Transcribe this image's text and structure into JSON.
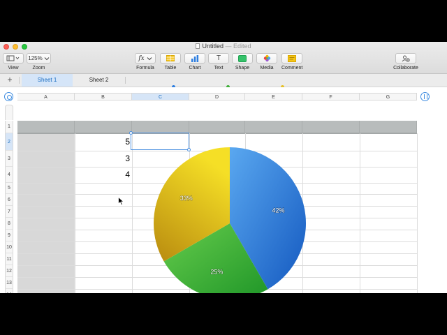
{
  "window": {
    "title": "Untitled",
    "status": "— Edited"
  },
  "toolbar": {
    "view": {
      "label": "View"
    },
    "zoom": {
      "label": "Zoom",
      "value": "125%"
    },
    "formula": {
      "label": "Formula",
      "button_text": "fx"
    },
    "table": {
      "label": "Table"
    },
    "chart": {
      "label": "Chart"
    },
    "text": {
      "label": "Text",
      "button_text": "T"
    },
    "shape": {
      "label": "Shape"
    },
    "media": {
      "label": "Media"
    },
    "comment": {
      "label": "Comment"
    },
    "collaborate": {
      "label": "Collaborate"
    }
  },
  "sheets": {
    "add": "+",
    "tabs": [
      {
        "label": "Sheet 1",
        "active": true
      },
      {
        "label": "Sheet 2",
        "active": false
      }
    ]
  },
  "columns": [
    "A",
    "B",
    "C",
    "D",
    "E",
    "F",
    "G"
  ],
  "rows": [
    "1",
    "2",
    "3",
    "4",
    "5",
    "6",
    "7",
    "8",
    "9",
    "10",
    "11",
    "12",
    "13",
    "14"
  ],
  "selection": {
    "column": "C",
    "row": "2"
  },
  "cells": {
    "B2": "5",
    "B3": "3",
    "B4": "4"
  },
  "chart_data": {
    "type": "pie",
    "values": [
      5,
      3,
      4
    ],
    "labels": [
      "42%",
      "25%",
      "33%"
    ],
    "colors": [
      "#3a8de0",
      "#43b236",
      "#e2c21c"
    ]
  },
  "colors": {
    "accent": "#1b6ec2",
    "selection_border": "#4a8fe0",
    "header_row": "#b8bcbc",
    "header_col": "#d8d8d8"
  }
}
